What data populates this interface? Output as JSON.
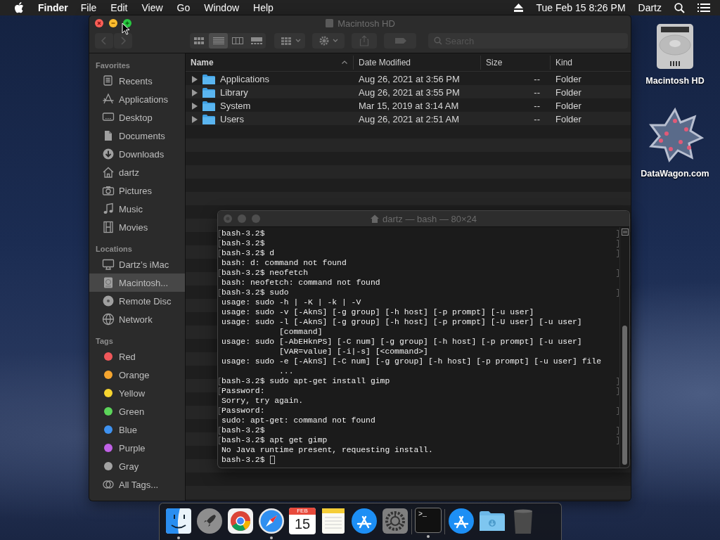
{
  "menu_bar": {
    "app": "Finder",
    "menus": [
      "File",
      "Edit",
      "View",
      "Go",
      "Window",
      "Help"
    ],
    "clock": "Tue Feb 15  8:26 PM",
    "user": "Dartz"
  },
  "finder": {
    "title": "Macintosh HD",
    "active": true,
    "views": [
      {
        "kind": "icons",
        "selected": false
      },
      {
        "kind": "list",
        "selected": true
      },
      {
        "kind": "columns",
        "selected": false
      },
      {
        "kind": "gallery",
        "selected": false
      }
    ],
    "search_placeholder": "Search",
    "sidebar": [
      {
        "heading": "Favorites",
        "items": [
          {
            "label": "Recents",
            "kind": "recents",
            "selected": false
          },
          {
            "label": "Applications",
            "kind": "applications",
            "selected": false
          },
          {
            "label": "Desktop",
            "kind": "desktop",
            "selected": false
          },
          {
            "label": "Documents",
            "kind": "documents",
            "selected": false
          },
          {
            "label": "Downloads",
            "kind": "downloads",
            "selected": false
          },
          {
            "label": "dartz",
            "kind": "home",
            "selected": false
          },
          {
            "label": "Pictures",
            "kind": "pictures",
            "selected": false
          },
          {
            "label": "Music",
            "kind": "music",
            "selected": false
          },
          {
            "label": "Movies",
            "kind": "movies",
            "selected": false
          }
        ]
      },
      {
        "heading": "Locations",
        "items": [
          {
            "label": "Dartz’s iMac",
            "kind": "computer",
            "selected": false
          },
          {
            "label": "Macintosh...",
            "kind": "disk",
            "selected": true
          },
          {
            "label": "Remote Disc",
            "kind": "disc",
            "selected": false
          },
          {
            "label": "Network",
            "kind": "network",
            "selected": false
          }
        ]
      },
      {
        "heading": "Tags",
        "items": [
          {
            "label": "Red",
            "kind": "tag",
            "color": "#f0575a",
            "selected": false
          },
          {
            "label": "Orange",
            "kind": "tag",
            "color": "#f5a52f",
            "selected": false
          },
          {
            "label": "Yellow",
            "kind": "tag",
            "color": "#f7d530",
            "selected": false
          },
          {
            "label": "Green",
            "kind": "tag",
            "color": "#5cd55a",
            "selected": false
          },
          {
            "label": "Blue",
            "kind": "tag",
            "color": "#3f92f0",
            "selected": false
          },
          {
            "label": "Purple",
            "kind": "tag",
            "color": "#c061e6",
            "selected": false
          },
          {
            "label": "Gray",
            "kind": "tag",
            "color": "#a3a3a3",
            "selected": false
          },
          {
            "label": "All Tags...",
            "kind": "alltags",
            "selected": false
          }
        ]
      }
    ],
    "columns": [
      {
        "label": "Name",
        "sorted": true
      },
      {
        "label": "Date Modified",
        "sorted": false
      },
      {
        "label": "Size",
        "sorted": false
      },
      {
        "label": "Kind",
        "sorted": false
      }
    ],
    "rows": [
      {
        "name": "Applications",
        "date": "Aug 26, 2021 at 3:56 PM",
        "size": "--",
        "kind": "Folder"
      },
      {
        "name": "Library",
        "date": "Aug 26, 2021 at 3:55 PM",
        "size": "--",
        "kind": "Folder"
      },
      {
        "name": "System",
        "date": "Mar 15, 2019 at 3:14 AM",
        "size": "--",
        "kind": "Folder"
      },
      {
        "name": "Users",
        "date": "Aug 26, 2021 at 2:51 AM",
        "size": "--",
        "kind": "Folder"
      }
    ]
  },
  "terminal": {
    "title": "dartz — bash — 80×24",
    "active": false,
    "cursor": true,
    "lines": [
      {
        "text": "bash-3.2$",
        "marked": true
      },
      {
        "text": "bash-3.2$",
        "marked": true
      },
      {
        "text": "bash-3.2$ d",
        "marked": true
      },
      {
        "text": "bash: d: command not found",
        "marked": false
      },
      {
        "text": "bash-3.2$ neofetch",
        "marked": true
      },
      {
        "text": "bash: neofetch: command not found",
        "marked": false
      },
      {
        "text": "bash-3.2$ sudo",
        "marked": true
      },
      {
        "text": "usage: sudo -h | -K | -k | -V",
        "marked": false
      },
      {
        "text": "usage: sudo -v [-AknS] [-g group] [-h host] [-p prompt] [-u user]",
        "marked": false
      },
      {
        "text": "usage: sudo -l [-AknS] [-g group] [-h host] [-p prompt] [-U user] [-u user]",
        "marked": false
      },
      {
        "text": "            [command]",
        "marked": false
      },
      {
        "text": "usage: sudo [-AbEHknPS] [-C num] [-g group] [-h host] [-p prompt] [-u user]",
        "marked": false
      },
      {
        "text": "            [VAR=value] [-i|-s] [<command>]",
        "marked": false
      },
      {
        "text": "usage: sudo -e [-AknS] [-C num] [-g group] [-h host] [-p prompt] [-u user] file",
        "marked": false
      },
      {
        "text": "            ...",
        "marked": false
      },
      {
        "text": "bash-3.2$ sudo apt-get install gimp",
        "marked": true
      },
      {
        "text": "Password:",
        "marked": true
      },
      {
        "text": "Sorry, try again.",
        "marked": false
      },
      {
        "text": "Password:",
        "marked": true
      },
      {
        "text": "sudo: apt-get: command not found",
        "marked": false
      },
      {
        "text": "bash-3.2$",
        "marked": true
      },
      {
        "text": "bash-3.2$ apt get gimp",
        "marked": true
      },
      {
        "text": "No Java runtime present, requesting install.",
        "marked": false
      },
      {
        "text": "bash-3.2$",
        "marked": false
      }
    ]
  },
  "desktop_icons": [
    {
      "label": "Macintosh HD",
      "kind": "disk"
    },
    {
      "label": "DataWagon.com",
      "kind": "star"
    }
  ],
  "dock": [
    {
      "kind": "finder",
      "running": true
    },
    {
      "kind": "launchpad",
      "running": false
    },
    {
      "kind": "chrome",
      "running": false
    },
    {
      "kind": "safari",
      "running": true
    },
    {
      "kind": "calendar",
      "month": "FEB",
      "day": "15",
      "running": false
    },
    {
      "kind": "notes",
      "running": false
    },
    {
      "kind": "appstore",
      "running": false
    },
    {
      "kind": "preferences",
      "running": false
    },
    {
      "kind": "separator"
    },
    {
      "kind": "terminal",
      "prompt": ">_",
      "running": true
    },
    {
      "kind": "separator"
    },
    {
      "kind": "appstore",
      "running": false
    },
    {
      "kind": "downloads",
      "running": false
    },
    {
      "kind": "trash",
      "running": false
    }
  ]
}
